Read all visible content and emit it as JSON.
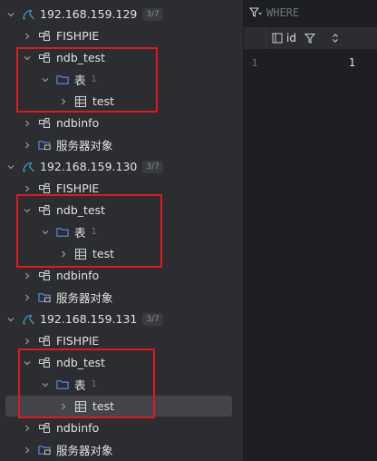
{
  "tree": {
    "hosts": [
      {
        "name": "192.168.159.129",
        "badge": "3/7",
        "databases": [
          "FISHPIE",
          "ndb_test",
          "ndbinfo"
        ],
        "tables_folder": "表",
        "tables_count": "1",
        "table": "test",
        "server_objects": "服务器对象"
      },
      {
        "name": "192.168.159.130",
        "badge": "3/7",
        "databases": [
          "FISHPIE",
          "ndb_test",
          "ndbinfo"
        ],
        "tables_folder": "表",
        "tables_count": "1",
        "table": "test",
        "server_objects": "服务器对象"
      },
      {
        "name": "192.168.159.131",
        "badge": "3/7",
        "databases": [
          "FISHPIE",
          "ndb_test",
          "ndbinfo"
        ],
        "tables_folder": "表",
        "tables_count": "1",
        "table": "test",
        "server_objects": "服务器对象"
      }
    ]
  },
  "grid": {
    "filter_placeholder": "WHERE",
    "column": "id",
    "rows": [
      {
        "num": "1",
        "id": "1"
      }
    ]
  },
  "colors": {
    "highlight_box": "#e0191f",
    "folder": "#5c8ee6",
    "mysql": "#3d9fd9"
  }
}
